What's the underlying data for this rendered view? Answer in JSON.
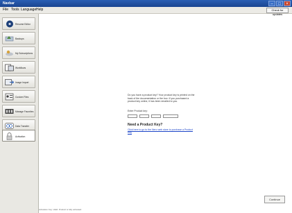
{
  "window": {
    "title": "Navbar"
  },
  "menu": {
    "items": [
      "File",
      "Tools",
      "Language",
      "Help"
    ],
    "update_label": "Check for updates"
  },
  "sidebar": {
    "items": [
      {
        "label": "Resume Editor",
        "icon": "disc-icon"
      },
      {
        "label": "Backups",
        "icon": "backup-icon"
      },
      {
        "label": "My Subscriptions",
        "icon": "subscriptions-icon"
      },
      {
        "label": "Workflows",
        "icon": "workflow-icon"
      },
      {
        "label": "Image Import",
        "icon": "import-icon"
      },
      {
        "label": "Custom Files",
        "icon": "files-icon"
      },
      {
        "label": "Manage Favorites",
        "icon": "favorites-icon"
      },
      {
        "label": "Data Transfer",
        "icon": "transfer-icon"
      },
      {
        "label": "Activation",
        "icon": "lock-icon"
      }
    ]
  },
  "activation": {
    "description": "Do you have a product key? Your product key is printed on the back of the documentation or the box. If you purchased a product key online, it has been emailed to you.",
    "enter_label": "Enter Product key:",
    "need_key_heading": "Need a Product Key?",
    "buy_link": "Click here to go to the Nero web store to purchase a Product Key"
  },
  "buttons": {
    "continue": "Continue"
  },
  "status": {
    "text": "Activation Key: Valid. Product is fully activated."
  }
}
